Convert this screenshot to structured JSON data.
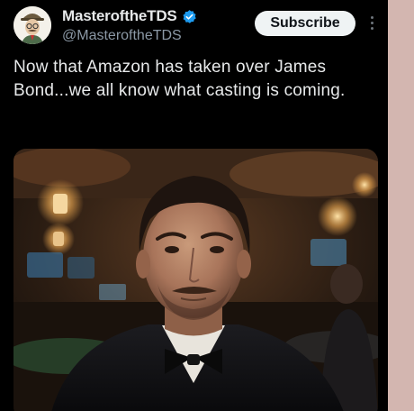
{
  "post": {
    "display_name": "MasteroftheTDS",
    "handle": "@MasteroftheTDS",
    "verified": true,
    "subscribe_label": "Subscribe",
    "text": "Now that Amazon has taken over James Bond...we all know what casting is coming.",
    "media": {
      "kind": "photo"
    }
  },
  "colors": {
    "background": "#000000",
    "text": "#e7e9ea",
    "secondary_text": "#8b98a5",
    "verified_badge": "#1d9bf0",
    "subscribe_bg": "#eff3f4"
  },
  "icons": {
    "verified": "verified-badge-icon",
    "more": "more-options-icon"
  }
}
